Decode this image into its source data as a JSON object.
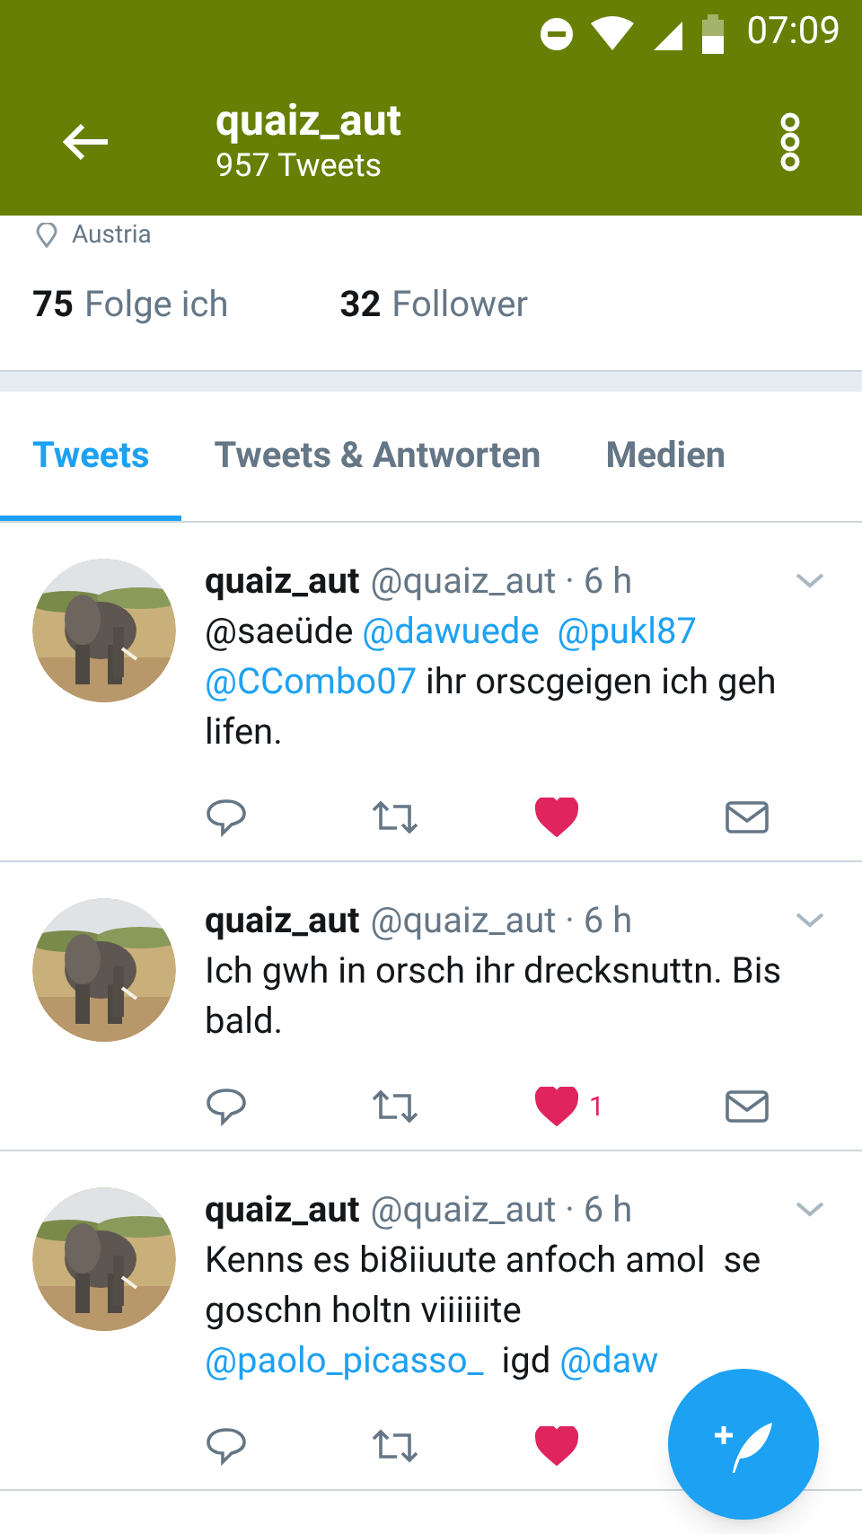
{
  "status_bar": {
    "time": "07:09"
  },
  "app_bar": {
    "title": "quaiz_aut",
    "subtitle": "957 Tweets"
  },
  "profile": {
    "location": "Austria",
    "following_count": "75",
    "following_label": "Folge ich",
    "followers_count": "32",
    "followers_label": "Follower"
  },
  "tabs": [
    {
      "label": "Tweets",
      "selected": true
    },
    {
      "label": "Tweets & Antworten",
      "selected": false
    },
    {
      "label": "Medien",
      "selected": false
    }
  ],
  "tweets": [
    {
      "name": "quaiz_aut",
      "handle": "@quaiz_aut · 6 h",
      "segments": [
        {
          "kind": "text",
          "text": "@saeüde "
        },
        {
          "kind": "mention",
          "text": "@dawuede  "
        },
        {
          "kind": "mention",
          "text": "@pukl87 "
        },
        {
          "kind": "mention",
          "text": "@CCombo07"
        },
        {
          "kind": "text",
          "text": " ihr orscgeigen ich geh lifen."
        }
      ],
      "liked": true,
      "mail": true
    },
    {
      "name": "quaiz_aut",
      "handle": "@quaiz_aut · 6 h",
      "segments": [
        {
          "kind": "text",
          "text": "Ich gwh in orsch ihr drecksnuttn. Bis bald."
        }
      ],
      "liked": true,
      "like_count": "1",
      "mail": true
    },
    {
      "name": "quaiz_aut",
      "handle": "@quaiz_aut · 6 h",
      "segments": [
        {
          "kind": "text",
          "text": "Kenns es bi8iiuute anfoch amol  se goschn holtn viiiiiite "
        },
        {
          "kind": "mention",
          "text": "@paolo_picasso_"
        },
        {
          "kind": "text",
          "text": "  igd "
        },
        {
          "kind": "mention",
          "text": "@daw"
        }
      ],
      "liked": true,
      "mail": false
    }
  ]
}
